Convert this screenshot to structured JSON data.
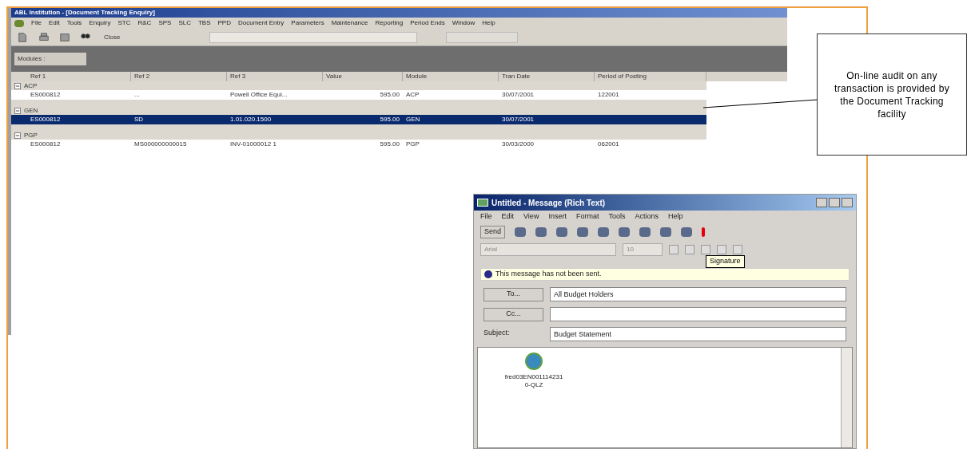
{
  "app_window": {
    "title": "ABL Institution - [Document Tracking Enquiry]",
    "menu": [
      "File",
      "Edit",
      "Tools",
      "Enquiry",
      "STC",
      "R&C",
      "SPS",
      "SLC",
      "TBS",
      "PPD",
      "Document Entry",
      "Parameters",
      "Maintenance",
      "Reporting",
      "Period Ends",
      "Window",
      "Help"
    ],
    "toolbar": {
      "close_label": "Close"
    },
    "modules_label": "Modules :",
    "table": {
      "columns": [
        "Ref 1",
        "Ref 2",
        "Ref 3",
        "Value",
        "Module",
        "Tran Date",
        "Period of Posting"
      ],
      "groups": [
        {
          "name": "ACP",
          "expanded": true,
          "rows": [
            {
              "selected": false,
              "cells": [
                "ES000812",
                "...",
                "Powell Office Equi...",
                "595.00",
                "ACP",
                "30/07/2001",
                "122001"
              ]
            }
          ]
        },
        {
          "name": "GEN",
          "expanded": true,
          "rows": [
            {
              "selected": true,
              "cells": [
                "ES000812",
                "SD",
                "1.01.020.1500",
                "595.00",
                "GEN",
                "30/07/2001",
                ""
              ]
            }
          ]
        },
        {
          "name": "PGP",
          "expanded": true,
          "rows": [
            {
              "selected": false,
              "cells": [
                "ES000812",
                "MS000000000015",
                "INV-01000012 1",
                "595.00",
                "PGP",
                "30/03/2000",
                "062001"
              ]
            }
          ]
        }
      ]
    }
  },
  "callout": {
    "text": "On-line audit on any transaction is provided by the Document Tracking facility"
  },
  "message_window": {
    "title": "Untitled - Message (Rich Text)",
    "menu": [
      "File",
      "Edit",
      "View",
      "Insert",
      "Format",
      "Tools",
      "Actions",
      "Help"
    ],
    "send_label": "Send",
    "font": "Arial",
    "font_size": "10",
    "tooltip": "Signature",
    "info": "This message has not been sent.",
    "to_label": "To...",
    "to_value": "All Budget Holders",
    "cc_label": "Cc...",
    "subject_label": "Subject:",
    "subject_value": "Budget Statement",
    "attachment": [
      "fred03EN001114231",
      "0-QLZ"
    ]
  }
}
